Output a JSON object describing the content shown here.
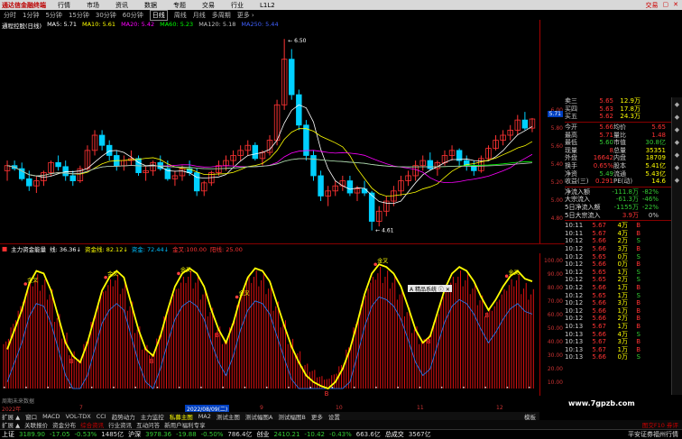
{
  "menubar": {
    "logo": "通达信金融终端",
    "items": [
      "行情",
      "市场",
      "资讯",
      "数据",
      "专题",
      "交易",
      "行业",
      "L1L2"
    ],
    "right": [
      "交易",
      "▢",
      "✕"
    ]
  },
  "periods": {
    "items": [
      "分时",
      "1分钟",
      "5分钟",
      "15分钟",
      "30分钟",
      "60分钟",
      "日线",
      "周线",
      "月线",
      "多周期",
      "更多 ›"
    ],
    "active": 6
  },
  "ma_legend": {
    "name": "通程控股(日线)",
    "items": [
      {
        "label": "MA5: 5.71",
        "color": "#ffffff"
      },
      {
        "label": "MA10: 5.61",
        "color": "#ffff00"
      },
      {
        "label": "MA20: 5.42",
        "color": "#ff00ff"
      },
      {
        "label": "MA60: 5.23",
        "color": "#00ff00"
      },
      {
        "label": "MA120: 5.18",
        "color": "#c0c0c0"
      },
      {
        "label": "MA250: 5.44",
        "color": "#4060ff"
      }
    ]
  },
  "price_axis": [
    "6.00",
    "5.80",
    "5.60",
    "5.40",
    "5.20",
    "5.00",
    "4.80"
  ],
  "price_marks": {
    "high": "6.50",
    "low": "4.61",
    "cursor_price": "5.71"
  },
  "sub_legend": {
    "name": "主力资金能量",
    "items": [
      {
        "label": "线: 36.36↓",
        "color": "#ffffff"
      },
      {
        "label": "资金线: 82.12↓",
        "color": "#ffff00"
      },
      {
        "label": "资金: 72.44↓",
        "color": "#00bfff"
      },
      {
        "label": "金叉:100.00",
        "color": "#ff3333"
      },
      {
        "label": "阳线: 25.00",
        "color": "#ff3333"
      }
    ]
  },
  "sub_axis": [
    "100.00",
    "90.00",
    "80.00",
    "70.00",
    "60.00",
    "50.00",
    "40.00",
    "30.00",
    "20.00",
    "10.00"
  ],
  "sub_labels": {
    "golden_cross": "金叉",
    "buy": "B",
    "popup": "A 精品系统 ⓘ ✕"
  },
  "dates": {
    "year": "2022年",
    "m7": "7",
    "m8": "8",
    "m9": "9",
    "m10": "10",
    "m11": "11",
    "m12": "12",
    "cursor": "2022/08/09(二)",
    "scroll": "模板"
  },
  "hint": "周期未来数据",
  "tabs1": {
    "items": [
      "扩展 ▲",
      "窗口",
      "MACD",
      "VOL-TDX",
      "CCI",
      "趋势动力",
      "主力监控",
      "私募主图",
      "MA2",
      "测试主图",
      "测试幅图A",
      "测试幅图B",
      "更多",
      "设置"
    ],
    "selected": 7,
    "right": "模板"
  },
  "tabs2": {
    "items": [
      "扩展 ▲",
      "关联报价",
      "资金分布",
      "综合资讯",
      "行业资讯",
      "互动问答",
      "新用户福利专享"
    ],
    "selected": 3,
    "right": "图交F10 券评"
  },
  "indices": [
    {
      "name": "上证",
      "value": "3189.90",
      "chg": "-17.05",
      "pct": "-0.53%",
      "vol": "1485亿"
    },
    {
      "name": "沪深",
      "value": "3978.36",
      "chg": "-19.88",
      "pct": "-0.50%",
      "vol": "786.4亿"
    },
    {
      "name": "创业",
      "value": "2410.21",
      "chg": "-10.42",
      "pct": "-0.43%",
      "vol": "663.6亿"
    },
    {
      "name": "总成交",
      "value": "3567亿",
      "chg": "",
      "pct": "",
      "vol": ""
    }
  ],
  "brand": "平安证券福州行情",
  "quote": {
    "asks": [
      {
        "label": "卖三",
        "price": "5.65",
        "vol": "12.9万"
      },
      {
        "label": "买四",
        "price": "5.63",
        "vol": "17.8万"
      },
      {
        "label": "买五",
        "price": "5.62",
        "vol": "24.3万"
      }
    ],
    "info": [
      [
        "今开",
        "5.66",
        "均价",
        "5.65"
      ],
      [
        "最高",
        "5.71",
        "量比",
        "1.48"
      ],
      [
        "最低",
        "5.60",
        "市值",
        "30.8亿"
      ],
      [
        "现量",
        "8",
        "总量",
        "35351"
      ],
      [
        "外盘",
        "16642",
        "内盘",
        "18709"
      ],
      [
        "换手",
        "0.65%",
        "股本",
        "5.41亿"
      ],
      [
        "净资",
        "5.49",
        "流通",
        "5.43亿"
      ],
      [
        "收益(三)",
        "0.291",
        "PE(动)",
        "14.6"
      ]
    ],
    "flow": [
      {
        "label": "净流入额",
        "value": "-111.8万",
        "pct": "-82%"
      },
      {
        "label": "大宗流入",
        "value": "-61.3万",
        "pct": "-46%"
      },
      {
        "label": "5日净流入额",
        "value": "-1155万",
        "pct": "-22%"
      },
      {
        "label": "5日大宗流入",
        "value": "3.9万",
        "pct": "0%"
      }
    ]
  },
  "ticks": [
    [
      "10:11",
      "5.67",
      "4",
      "万",
      "B"
    ],
    [
      "10:11",
      "5.67",
      "4",
      "万",
      "B"
    ],
    [
      "10:12",
      "5.66",
      "2",
      "万",
      "S"
    ],
    [
      "10:12",
      "5.66",
      "3",
      "万",
      "B"
    ],
    [
      "10:12",
      "5.65",
      "0",
      "万",
      "S"
    ],
    [
      "10:12",
      "5.66",
      "0",
      "万",
      "B"
    ],
    [
      "10:12",
      "5.65",
      "1",
      "万",
      "S"
    ],
    [
      "10:12",
      "5.65",
      "2",
      "万",
      "S"
    ],
    [
      "10:12",
      "5.66",
      "1",
      "万",
      "B"
    ],
    [
      "10:12",
      "5.65",
      "1",
      "万",
      "S"
    ],
    [
      "10:12",
      "5.66",
      "3",
      "万",
      "B"
    ],
    [
      "10:12",
      "5.66",
      "1",
      "万",
      "B"
    ],
    [
      "10:12",
      "5.66",
      "2",
      "万",
      "B"
    ],
    [
      "10:13",
      "5.67",
      "1",
      "万",
      "B"
    ],
    [
      "10:13",
      "5.66",
      "4",
      "万",
      "S"
    ],
    [
      "10:13",
      "5.67",
      "3",
      "万",
      "B"
    ],
    [
      "10:13",
      "5.67",
      "1",
      "万",
      "B"
    ],
    [
      "10:13",
      "5.66",
      "0",
      "万",
      "S"
    ],
    [
      "10:13",
      "5.66",
      "4",
      "万",
      "S"
    ],
    [
      "10:13",
      "5.66",
      "1",
      "万",
      "S"
    ],
    [
      "10:13",
      "5.67",
      "1",
      "万",
      "B"
    ],
    [
      "10:13",
      "5.66",
      "2",
      "万",
      "S"
    ],
    [
      "10:13",
      "5.67",
      "5",
      "万",
      "B"
    ],
    [
      "10:13",
      "5.67",
      "1",
      "万",
      "B"
    ],
    [
      "10:13",
      "5.66",
      "3",
      "万",
      "S"
    ],
    [
      "10:13",
      "5.67",
      "5",
      "万",
      "B"
    ]
  ],
  "watermark": "www.7gpzb.com",
  "chart_data": {
    "type": "candlestick",
    "candles": [
      [
        5.2,
        5.3,
        5.1,
        5.25
      ],
      [
        5.25,
        5.3,
        5.2,
        5.22
      ],
      [
        5.22,
        5.28,
        5.1,
        5.12
      ],
      [
        5.12,
        5.2,
        5.0,
        5.05
      ],
      [
        5.05,
        5.15,
        4.98,
        5.1
      ],
      [
        5.1,
        5.2,
        5.05,
        5.18
      ],
      [
        5.18,
        5.3,
        5.15,
        5.28
      ],
      [
        5.28,
        5.35,
        5.2,
        5.24
      ],
      [
        5.24,
        5.3,
        5.1,
        5.15
      ],
      [
        5.15,
        5.2,
        5.05,
        5.1
      ],
      [
        5.1,
        5.25,
        5.08,
        5.22
      ],
      [
        5.22,
        5.45,
        5.2,
        5.4
      ],
      [
        5.4,
        5.6,
        5.35,
        5.55
      ],
      [
        5.55,
        5.6,
        5.4,
        5.45
      ],
      [
        5.45,
        5.5,
        5.3,
        5.35
      ],
      [
        5.35,
        5.4,
        5.2,
        5.25
      ],
      [
        5.25,
        5.35,
        5.2,
        5.3
      ],
      [
        5.3,
        5.4,
        5.25,
        5.32
      ],
      [
        5.32,
        5.35,
        5.15,
        5.18
      ],
      [
        5.18,
        5.25,
        5.1,
        5.2
      ],
      [
        5.2,
        5.3,
        5.15,
        5.28
      ],
      [
        5.28,
        5.35,
        5.2,
        5.22
      ],
      [
        5.22,
        5.3,
        5.1,
        5.12
      ],
      [
        5.12,
        5.2,
        5.05,
        5.15
      ],
      [
        5.15,
        5.25,
        5.1,
        5.22
      ],
      [
        5.22,
        5.3,
        5.15,
        5.18
      ],
      [
        5.18,
        5.22,
        4.95,
        5.0
      ],
      [
        5.0,
        5.1,
        4.95,
        5.08
      ],
      [
        5.08,
        5.2,
        5.05,
        5.18
      ],
      [
        5.18,
        5.3,
        5.15,
        5.25
      ],
      [
        5.25,
        5.35,
        5.2,
        5.3
      ],
      [
        5.3,
        5.4,
        5.25,
        5.35
      ],
      [
        5.35,
        5.45,
        5.3,
        5.4
      ],
      [
        5.4,
        5.5,
        5.35,
        5.45
      ],
      [
        5.45,
        5.48,
        5.3,
        5.32
      ],
      [
        5.32,
        5.4,
        5.25,
        5.38
      ],
      [
        5.38,
        5.55,
        5.35,
        5.5
      ],
      [
        5.5,
        5.9,
        5.45,
        5.85
      ],
      [
        5.85,
        6.5,
        5.8,
        6.3
      ],
      [
        6.3,
        6.4,
        5.9,
        5.95
      ],
      [
        5.95,
        6.0,
        5.6,
        5.65
      ],
      [
        5.65,
        5.7,
        5.3,
        5.35
      ],
      [
        5.35,
        5.4,
        5.1,
        5.15
      ],
      [
        5.15,
        5.2,
        4.9,
        4.95
      ],
      [
        4.95,
        5.05,
        4.85,
        5.0
      ],
      [
        5.0,
        5.1,
        4.95,
        5.05
      ],
      [
        5.05,
        5.15,
        5.0,
        5.1
      ],
      [
        5.1,
        5.15,
        4.95,
        4.98
      ],
      [
        4.98,
        5.05,
        4.9,
        5.02
      ],
      [
        5.02,
        5.1,
        4.95,
        4.98
      ],
      [
        4.98,
        5.0,
        4.61,
        4.7
      ],
      [
        4.7,
        4.85,
        4.65,
        4.8
      ],
      [
        4.8,
        4.95,
        4.75,
        4.9
      ],
      [
        4.9,
        5.05,
        4.85,
        5.0
      ],
      [
        5.0,
        5.15,
        4.95,
        5.1
      ],
      [
        5.1,
        5.2,
        5.05,
        5.15
      ],
      [
        5.15,
        5.3,
        5.1,
        5.25
      ],
      [
        5.25,
        5.35,
        5.2,
        5.3
      ],
      [
        5.3,
        5.38,
        5.2,
        5.22
      ],
      [
        5.22,
        5.3,
        5.15,
        5.28
      ],
      [
        5.28,
        5.4,
        5.25,
        5.35
      ],
      [
        5.35,
        5.45,
        5.3,
        5.4
      ],
      [
        5.4,
        5.42,
        5.25,
        5.3
      ],
      [
        5.3,
        5.35,
        5.2,
        5.25
      ],
      [
        5.25,
        5.3,
        5.15,
        5.2
      ],
      [
        5.2,
        5.35,
        5.18,
        5.32
      ],
      [
        5.32,
        5.45,
        5.3,
        5.42
      ],
      [
        5.42,
        5.55,
        5.4,
        5.5
      ],
      [
        5.5,
        5.6,
        5.45,
        5.55
      ],
      [
        5.55,
        5.65,
        5.5,
        5.6
      ],
      [
        5.6,
        5.75,
        5.55,
        5.7
      ],
      [
        5.7,
        5.78,
        5.6,
        5.62
      ],
      [
        5.62,
        5.72,
        5.58,
        5.71
      ]
    ],
    "energy": [
      40,
      55,
      70,
      85,
      92,
      88,
      80,
      60,
      45,
      30,
      25,
      40,
      60,
      78,
      88,
      92,
      85,
      70,
      50,
      35,
      30,
      45,
      65,
      80,
      90,
      95,
      90,
      80,
      65,
      50,
      40,
      55,
      75,
      90,
      95,
      92,
      85,
      70,
      55,
      40,
      30,
      20,
      15,
      10,
      8,
      12,
      20,
      35,
      55,
      75,
      90,
      98,
      95,
      90,
      80,
      65,
      50,
      40,
      45,
      60,
      78,
      90,
      95,
      92,
      85,
      75,
      65,
      70,
      80,
      88,
      92,
      85,
      80
    ],
    "line": [
      30,
      45,
      60,
      80,
      90,
      88,
      75,
      55,
      35,
      25,
      20,
      35,
      55,
      75,
      85,
      90,
      85,
      65,
      45,
      30,
      25,
      40,
      60,
      78,
      88,
      92,
      88,
      78,
      60,
      45,
      35,
      50,
      70,
      85,
      92,
      90,
      82,
      65,
      48,
      32,
      20,
      10,
      5,
      2,
      0,
      5,
      15,
      30,
      50,
      72,
      88,
      95,
      93,
      88,
      78,
      62,
      45,
      35,
      40,
      58,
      76,
      88,
      93,
      90,
      82,
      70,
      60,
      68,
      78,
      86,
      90,
      84,
      82
    ]
  }
}
